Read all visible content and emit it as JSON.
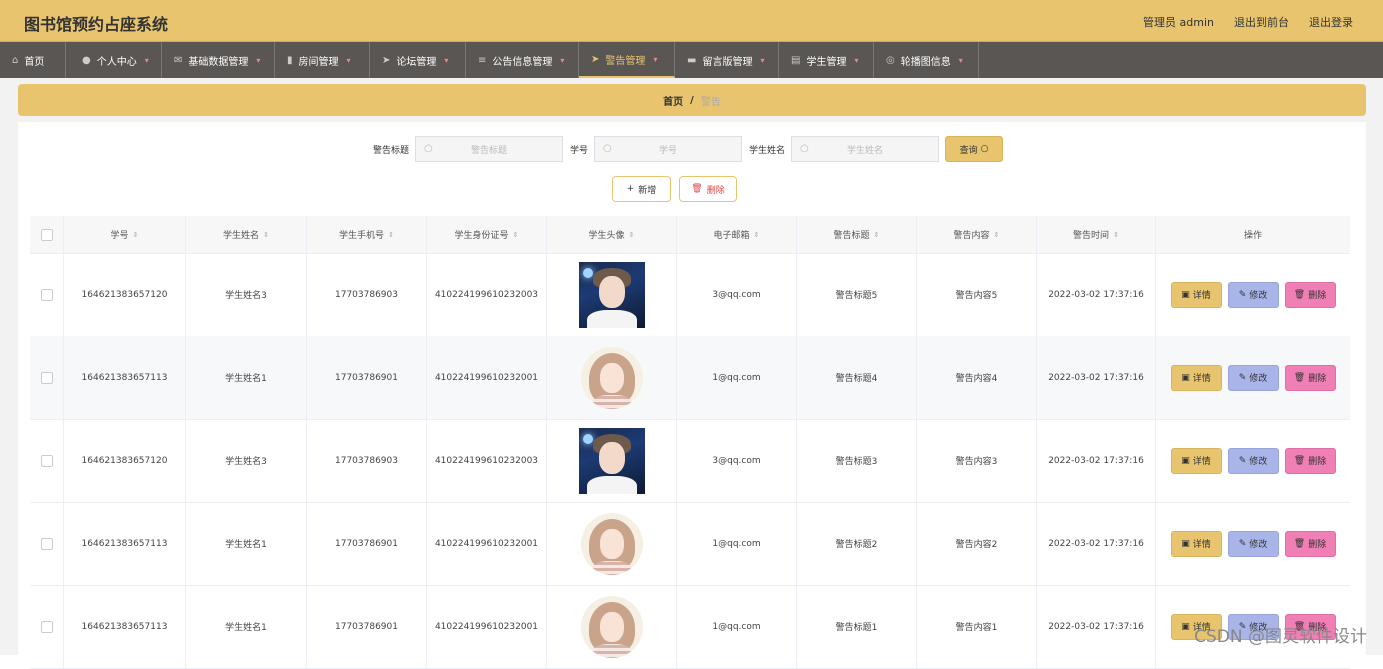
{
  "header": {
    "title": "图书馆预约占座系统",
    "links": [
      "管理员 admin",
      "退出到前台",
      "退出登录"
    ]
  },
  "nav": [
    {
      "label": "首页",
      "icon": "home-icon"
    },
    {
      "label": "个人中心",
      "icon": "user-icon"
    },
    {
      "label": "基础数据管理",
      "icon": "mail-icon"
    },
    {
      "label": "房间管理",
      "icon": "chart-icon"
    },
    {
      "label": "论坛管理",
      "icon": "send-icon"
    },
    {
      "label": "公告信息管理",
      "icon": "list-icon"
    },
    {
      "label": "警告管理",
      "icon": "send-icon"
    },
    {
      "label": "留言版管理",
      "icon": "box-icon"
    },
    {
      "label": "学生管理",
      "icon": "clipboard-icon"
    },
    {
      "label": "轮播图信息",
      "icon": "compass-icon"
    }
  ],
  "breadcrumb": {
    "home": "首页",
    "sep": "/",
    "current": "警告"
  },
  "search": {
    "fields": [
      {
        "label": "警告标题",
        "placeholder": "警告标题"
      },
      {
        "label": "学号",
        "placeholder": "学号"
      },
      {
        "label": "学生姓名",
        "placeholder": "学生姓名"
      }
    ],
    "query_label": "查询"
  },
  "actions": {
    "add_label": "新增",
    "delete_label": "删除"
  },
  "table": {
    "columns": [
      "学号",
      "学生姓名",
      "学生手机号",
      "学生身份证号",
      "学生头像",
      "电子邮箱",
      "警告标题",
      "警告内容",
      "警告时间",
      "操作"
    ],
    "rows": [
      {
        "id": "164621383657120",
        "name": "学生姓名3",
        "phone": "17703786903",
        "idcard": "410224199610232003",
        "avatar": "male",
        "email": "3@qq.com",
        "title": "警告标题5",
        "content": "警告内容5",
        "time": "2022-03-02 17:37:16"
      },
      {
        "id": "164621383657113",
        "name": "学生姓名1",
        "phone": "17703786901",
        "idcard": "410224199610232001",
        "avatar": "female",
        "email": "1@qq.com",
        "title": "警告标题4",
        "content": "警告内容4",
        "time": "2022-03-02 17:37:16"
      },
      {
        "id": "164621383657120",
        "name": "学生姓名3",
        "phone": "17703786903",
        "idcard": "410224199610232003",
        "avatar": "male",
        "email": "3@qq.com",
        "title": "警告标题3",
        "content": "警告内容3",
        "time": "2022-03-02 17:37:16"
      },
      {
        "id": "164621383657113",
        "name": "学生姓名1",
        "phone": "17703786901",
        "idcard": "410224199610232001",
        "avatar": "female",
        "email": "1@qq.com",
        "title": "警告标题2",
        "content": "警告内容2",
        "time": "2022-03-02 17:37:16"
      },
      {
        "id": "164621383657113",
        "name": "学生姓名1",
        "phone": "17703786901",
        "idcard": "410224199610232001",
        "avatar": "female",
        "email": "1@qq.com",
        "title": "警告标题1",
        "content": "警告内容1",
        "time": "2022-03-02 17:37:16"
      }
    ],
    "ops": {
      "detail": "详情",
      "edit": "修改",
      "delete": "删除"
    }
  },
  "watermark": "CSDN @图灵软件设计",
  "colors": {
    "accent": "#e8c46e",
    "nav_bg": "#595653",
    "edit": "#a9b4e8",
    "delete": "#f07fb5"
  }
}
